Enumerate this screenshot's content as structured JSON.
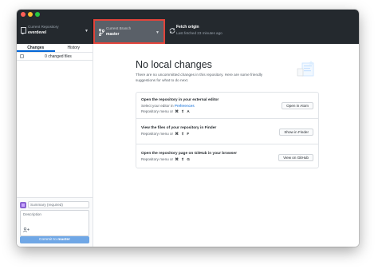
{
  "toolbar": {
    "repo": {
      "label": "Current Repository",
      "value": "everdevel"
    },
    "branch": {
      "label": "Current Branch",
      "value": "master"
    },
    "fetch": {
      "label": "Fetch origin",
      "sub": "Last fetched 23 minutes ago"
    },
    "accent": "#e2443b"
  },
  "sidebar": {
    "tabs": [
      {
        "label": "Changes",
        "selected": true
      },
      {
        "label": "History",
        "selected": false
      }
    ],
    "changed_files": "0 changed files",
    "commit": {
      "summary_placeholder": "Summary (required)",
      "description_placeholder": "Description",
      "button_prefix": "Commit to ",
      "button_branch": "master",
      "button_color": "#6fa7e6"
    }
  },
  "main": {
    "title": "No local changes",
    "subtitle": "There are no uncommitted changes in this repository. Here are some friendly suggestions for what to do next.",
    "suggestions": [
      {
        "title": "Open the repository in your external editor",
        "line1_prefix": "Select your editor in ",
        "line1_link": "Preferences",
        "line2": "Repository menu or",
        "keys": [
          "⌘",
          "⇧",
          "A"
        ],
        "button": "Open in Atom"
      },
      {
        "title": "View the files of your repository in Finder",
        "line2": "Repository menu or",
        "keys": [
          "⌘",
          "⇧",
          "F"
        ],
        "button": "Show in Finder"
      },
      {
        "title": "Open the repository page on GitHub in your browser",
        "line2": "Repository menu or",
        "keys": [
          "⌘",
          "⇧",
          "G"
        ],
        "button": "View on GitHub"
      }
    ]
  },
  "icons": {
    "repo": "repo-icon",
    "branch": "branch-icon",
    "fetch": "sync-icon",
    "caret": "caret-down-icon",
    "coauthor": "person-add-icon",
    "illustration": "empty-state-illustration"
  }
}
